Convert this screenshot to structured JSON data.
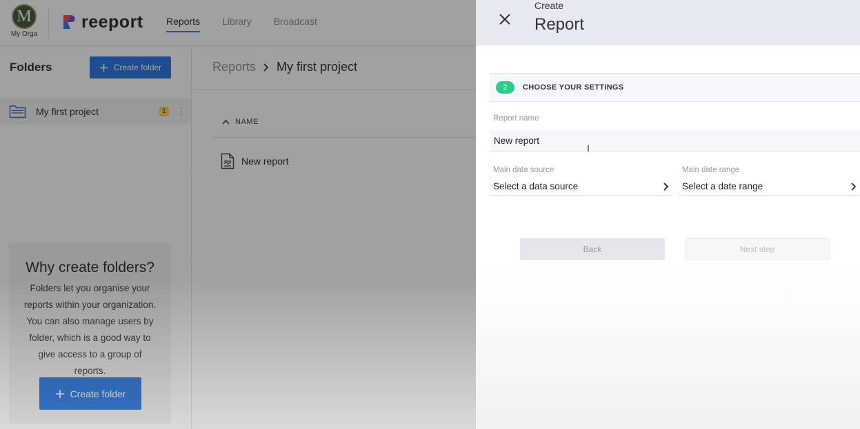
{
  "org": {
    "initial": "M",
    "name": "My Orga"
  },
  "brand": {
    "name": "reeport"
  },
  "nav": {
    "tabs": [
      {
        "label": "Reports"
      },
      {
        "label": "Library"
      },
      {
        "label": "Broadcast"
      }
    ]
  },
  "sidebar": {
    "title": "Folders",
    "create_label": "Create folder",
    "items": [
      {
        "label": "My first project",
        "count": "1"
      }
    ],
    "info": {
      "title": "Why create folders?",
      "text": "Folders let you organise your reports within your organization. You can also manage users by folder, which is a good way to give access to a group of reports.",
      "button_label": "Create folder"
    }
  },
  "content": {
    "breadcrumb": {
      "root": "Reports",
      "current": "My first project"
    },
    "column_header": "NAME",
    "rows": [
      {
        "label": "New report"
      }
    ]
  },
  "panel": {
    "subtitle": "Create",
    "title": "Report",
    "step": {
      "number": "2",
      "label": "CHOOSE YOUR SETTINGS"
    },
    "report_name": {
      "label": "Report name",
      "value": "New report"
    },
    "data_source": {
      "label": "Main data source",
      "value": "Select a data source"
    },
    "date_range": {
      "label": "Main date range",
      "value": "Select a date range"
    },
    "back_label": "Back",
    "next_label": "Next step"
  },
  "colors": {
    "accent": "#1f6fe0",
    "step_badge": "#2ecc8a",
    "badge": "#f5d64a"
  }
}
